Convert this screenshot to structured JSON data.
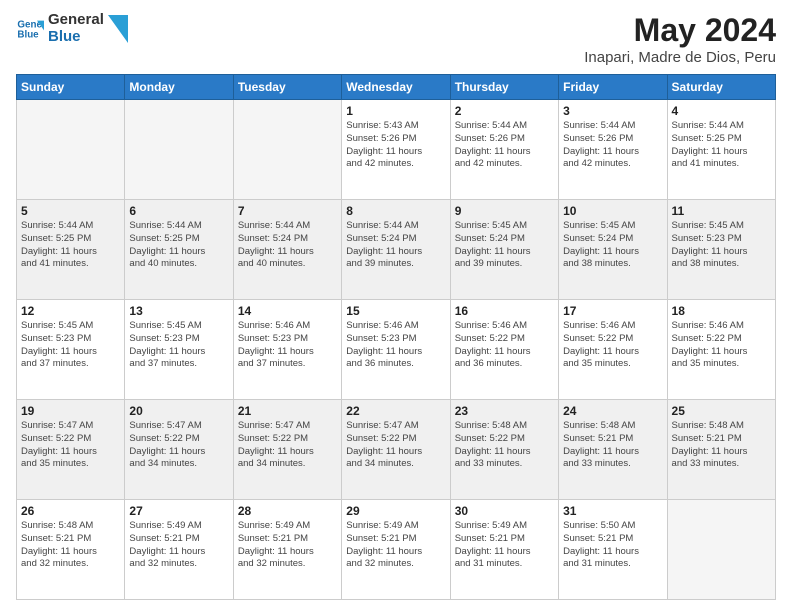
{
  "logo": {
    "line1": "General",
    "line2": "Blue"
  },
  "title": "May 2024",
  "subtitle": "Inapari, Madre de Dios, Peru",
  "days_of_week": [
    "Sunday",
    "Monday",
    "Tuesday",
    "Wednesday",
    "Thursday",
    "Friday",
    "Saturday"
  ],
  "weeks": [
    [
      {
        "day": "",
        "info": ""
      },
      {
        "day": "",
        "info": ""
      },
      {
        "day": "",
        "info": ""
      },
      {
        "day": "1",
        "info": "Sunrise: 5:43 AM\nSunset: 5:26 PM\nDaylight: 11 hours\nand 42 minutes."
      },
      {
        "day": "2",
        "info": "Sunrise: 5:44 AM\nSunset: 5:26 PM\nDaylight: 11 hours\nand 42 minutes."
      },
      {
        "day": "3",
        "info": "Sunrise: 5:44 AM\nSunset: 5:26 PM\nDaylight: 11 hours\nand 42 minutes."
      },
      {
        "day": "4",
        "info": "Sunrise: 5:44 AM\nSunset: 5:25 PM\nDaylight: 11 hours\nand 41 minutes."
      }
    ],
    [
      {
        "day": "5",
        "info": "Sunrise: 5:44 AM\nSunset: 5:25 PM\nDaylight: 11 hours\nand 41 minutes."
      },
      {
        "day": "6",
        "info": "Sunrise: 5:44 AM\nSunset: 5:25 PM\nDaylight: 11 hours\nand 40 minutes."
      },
      {
        "day": "7",
        "info": "Sunrise: 5:44 AM\nSunset: 5:24 PM\nDaylight: 11 hours\nand 40 minutes."
      },
      {
        "day": "8",
        "info": "Sunrise: 5:44 AM\nSunset: 5:24 PM\nDaylight: 11 hours\nand 39 minutes."
      },
      {
        "day": "9",
        "info": "Sunrise: 5:45 AM\nSunset: 5:24 PM\nDaylight: 11 hours\nand 39 minutes."
      },
      {
        "day": "10",
        "info": "Sunrise: 5:45 AM\nSunset: 5:24 PM\nDaylight: 11 hours\nand 38 minutes."
      },
      {
        "day": "11",
        "info": "Sunrise: 5:45 AM\nSunset: 5:23 PM\nDaylight: 11 hours\nand 38 minutes."
      }
    ],
    [
      {
        "day": "12",
        "info": "Sunrise: 5:45 AM\nSunset: 5:23 PM\nDaylight: 11 hours\nand 37 minutes."
      },
      {
        "day": "13",
        "info": "Sunrise: 5:45 AM\nSunset: 5:23 PM\nDaylight: 11 hours\nand 37 minutes."
      },
      {
        "day": "14",
        "info": "Sunrise: 5:46 AM\nSunset: 5:23 PM\nDaylight: 11 hours\nand 37 minutes."
      },
      {
        "day": "15",
        "info": "Sunrise: 5:46 AM\nSunset: 5:23 PM\nDaylight: 11 hours\nand 36 minutes."
      },
      {
        "day": "16",
        "info": "Sunrise: 5:46 AM\nSunset: 5:22 PM\nDaylight: 11 hours\nand 36 minutes."
      },
      {
        "day": "17",
        "info": "Sunrise: 5:46 AM\nSunset: 5:22 PM\nDaylight: 11 hours\nand 35 minutes."
      },
      {
        "day": "18",
        "info": "Sunrise: 5:46 AM\nSunset: 5:22 PM\nDaylight: 11 hours\nand 35 minutes."
      }
    ],
    [
      {
        "day": "19",
        "info": "Sunrise: 5:47 AM\nSunset: 5:22 PM\nDaylight: 11 hours\nand 35 minutes."
      },
      {
        "day": "20",
        "info": "Sunrise: 5:47 AM\nSunset: 5:22 PM\nDaylight: 11 hours\nand 34 minutes."
      },
      {
        "day": "21",
        "info": "Sunrise: 5:47 AM\nSunset: 5:22 PM\nDaylight: 11 hours\nand 34 minutes."
      },
      {
        "day": "22",
        "info": "Sunrise: 5:47 AM\nSunset: 5:22 PM\nDaylight: 11 hours\nand 34 minutes."
      },
      {
        "day": "23",
        "info": "Sunrise: 5:48 AM\nSunset: 5:22 PM\nDaylight: 11 hours\nand 33 minutes."
      },
      {
        "day": "24",
        "info": "Sunrise: 5:48 AM\nSunset: 5:21 PM\nDaylight: 11 hours\nand 33 minutes."
      },
      {
        "day": "25",
        "info": "Sunrise: 5:48 AM\nSunset: 5:21 PM\nDaylight: 11 hours\nand 33 minutes."
      }
    ],
    [
      {
        "day": "26",
        "info": "Sunrise: 5:48 AM\nSunset: 5:21 PM\nDaylight: 11 hours\nand 32 minutes."
      },
      {
        "day": "27",
        "info": "Sunrise: 5:49 AM\nSunset: 5:21 PM\nDaylight: 11 hours\nand 32 minutes."
      },
      {
        "day": "28",
        "info": "Sunrise: 5:49 AM\nSunset: 5:21 PM\nDaylight: 11 hours\nand 32 minutes."
      },
      {
        "day": "29",
        "info": "Sunrise: 5:49 AM\nSunset: 5:21 PM\nDaylight: 11 hours\nand 32 minutes."
      },
      {
        "day": "30",
        "info": "Sunrise: 5:49 AM\nSunset: 5:21 PM\nDaylight: 11 hours\nand 31 minutes."
      },
      {
        "day": "31",
        "info": "Sunrise: 5:50 AM\nSunset: 5:21 PM\nDaylight: 11 hours\nand 31 minutes."
      },
      {
        "day": "",
        "info": ""
      }
    ]
  ]
}
